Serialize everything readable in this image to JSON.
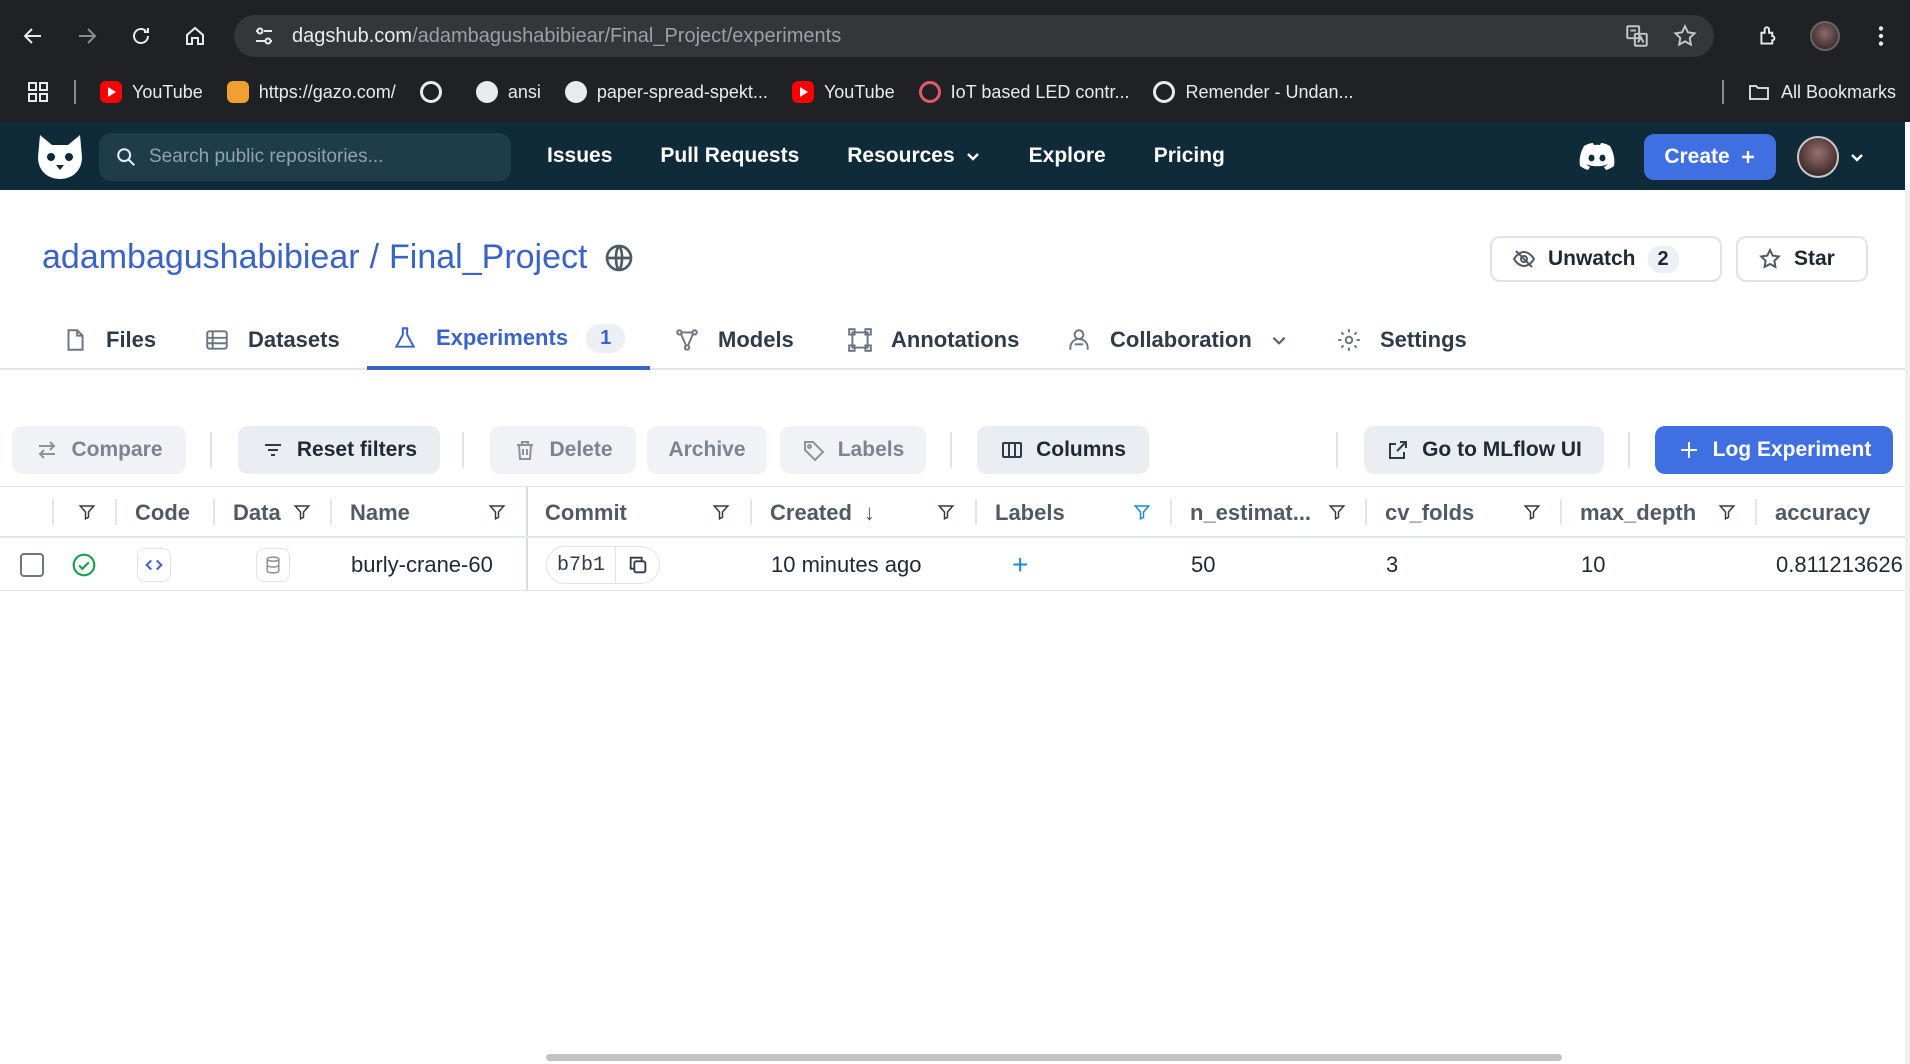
{
  "browser": {
    "url_host": "dagshub.com",
    "url_path": "/adambagushabibiear/Final_Project/experiments",
    "bookmarks": [
      {
        "label": "YouTube",
        "icon": "youtube-icon"
      },
      {
        "label": "https://gazo.com/",
        "icon": "site-icon"
      },
      {
        "label": "",
        "icon": "google-icon"
      },
      {
        "label": "ansi",
        "icon": "globe-icon"
      },
      {
        "label": "paper-spread-spekt...",
        "icon": "globe-icon"
      },
      {
        "label": "YouTube",
        "icon": "youtube-icon"
      },
      {
        "label": "IoT based LED contr...",
        "icon": "site-icon"
      },
      {
        "label": "Remender - Undan...",
        "icon": "google-icon"
      }
    ],
    "all_bookmarks": "All Bookmarks"
  },
  "header": {
    "search_placeholder": "Search public repositories...",
    "nav": [
      "Issues",
      "Pull Requests",
      "Resources",
      "Explore",
      "Pricing"
    ],
    "create_label": "Create"
  },
  "repo": {
    "owner": "adambagushabibiear",
    "separator": "/",
    "name": "Final_Project",
    "unwatch_label": "Unwatch",
    "watch_count": "2",
    "star_label": "Star"
  },
  "tabs": [
    {
      "label": "Files"
    },
    {
      "label": "Datasets"
    },
    {
      "label": "Experiments",
      "count": "1"
    },
    {
      "label": "Models"
    },
    {
      "label": "Annotations"
    },
    {
      "label": "Collaboration"
    },
    {
      "label": "Settings"
    }
  ],
  "toolbar": {
    "compare": "Compare",
    "reset_filters": "Reset filters",
    "delete": "Delete",
    "archive": "Archive",
    "labels": "Labels",
    "columns": "Columns",
    "mlflow": "Go to MLflow UI",
    "log_experiment": "Log Experiment"
  },
  "table": {
    "columns": [
      "Code",
      "Data",
      "Name",
      "Commit",
      "Created",
      "Labels",
      "n_estimat...",
      "cv_folds",
      "max_depth",
      "accuracy"
    ],
    "created_sort_arrow": "↓",
    "rows": [
      {
        "name": "burly-crane-60",
        "commit": "b7b1",
        "created": "10 minutes ago",
        "labels_add": "+",
        "n_estimators": "50",
        "cv_folds": "3",
        "max_depth": "10",
        "accuracy": "0.811213626"
      }
    ]
  },
  "colors": {
    "accent": "#3f6fe0",
    "header_bg": "#0f2a38",
    "status_success": "#1f9d55"
  }
}
